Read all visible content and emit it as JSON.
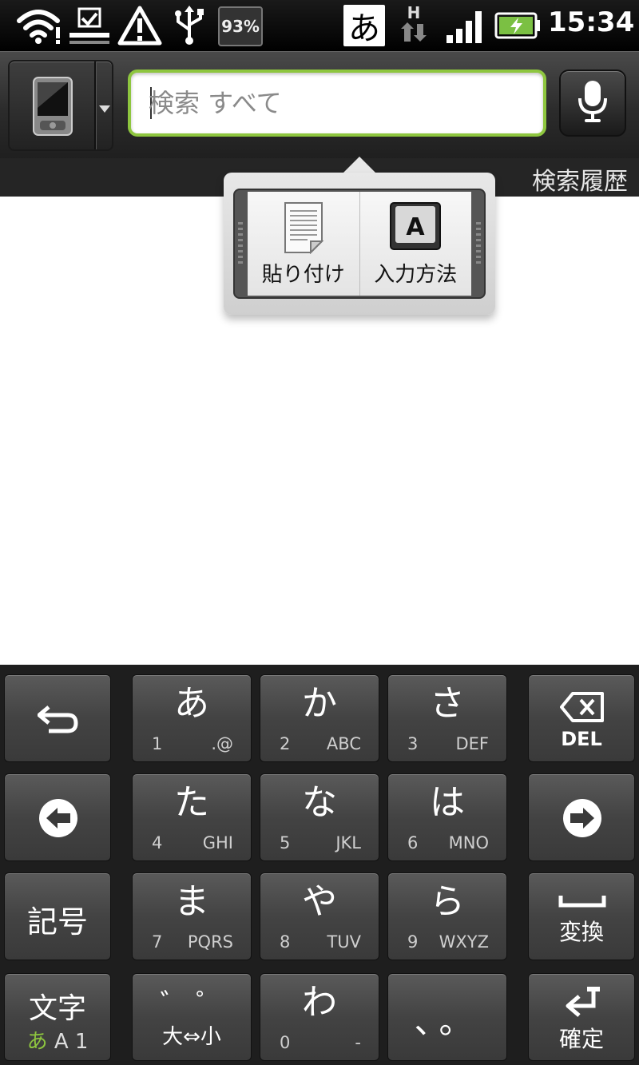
{
  "status_bar": {
    "battery_percent": "93%",
    "ime_indicator": "あ",
    "network_type": "H",
    "time": "15:34",
    "icons": [
      "wifi-icon",
      "download-complete-icon",
      "warning-icon",
      "usb-icon",
      "signal-icon",
      "battery-charging-icon"
    ]
  },
  "search": {
    "placeholder": "検索 すべて",
    "source_icon": "phone-icon",
    "voice_icon": "microphone-icon",
    "history_label": "検索履歴"
  },
  "popup": {
    "items": [
      {
        "label": "貼り付け",
        "icon": "paste-icon"
      },
      {
        "label": "入力方法",
        "icon": "input-method-icon",
        "icon_text": "A"
      }
    ]
  },
  "keyboard": {
    "rows": [
      [
        {
          "type": "side",
          "icon": "undo-icon"
        },
        {
          "main": "あ",
          "num": "1",
          "alpha": ".@"
        },
        {
          "main": "か",
          "num": "2",
          "alpha": "ABC"
        },
        {
          "main": "さ",
          "num": "3",
          "alpha": "DEF"
        },
        {
          "type": "side",
          "label": "DEL",
          "icon": "backspace-icon"
        }
      ],
      [
        {
          "type": "side",
          "icon": "arrow-left-icon"
        },
        {
          "main": "た",
          "num": "4",
          "alpha": "GHI"
        },
        {
          "main": "な",
          "num": "5",
          "alpha": "JKL"
        },
        {
          "main": "は",
          "num": "6",
          "alpha": "MNO"
        },
        {
          "type": "side",
          "icon": "arrow-right-icon"
        }
      ],
      [
        {
          "type": "side",
          "label": "記号"
        },
        {
          "main": "ま",
          "num": "7",
          "alpha": "PQRS"
        },
        {
          "main": "や",
          "num": "8",
          "alpha": "TUV"
        },
        {
          "main": "ら",
          "num": "9",
          "alpha": "WXYZ"
        },
        {
          "type": "side",
          "label": "変換",
          "icon": "space-icon"
        }
      ],
      [
        {
          "type": "side",
          "label": "文字",
          "sub_active": "あ",
          "sub_rest": "A 1"
        },
        {
          "main": "゛ ゜",
          "sub": "大⇔小"
        },
        {
          "main": "わ",
          "num": "0",
          "alpha": "-"
        },
        {
          "main": "、。"
        },
        {
          "type": "side",
          "label": "確定",
          "icon": "enter-icon"
        }
      ]
    ]
  },
  "colors": {
    "search_border": "#8ec63f",
    "ime_active": "#8ec63f",
    "battery_fill": "#7bc043"
  }
}
